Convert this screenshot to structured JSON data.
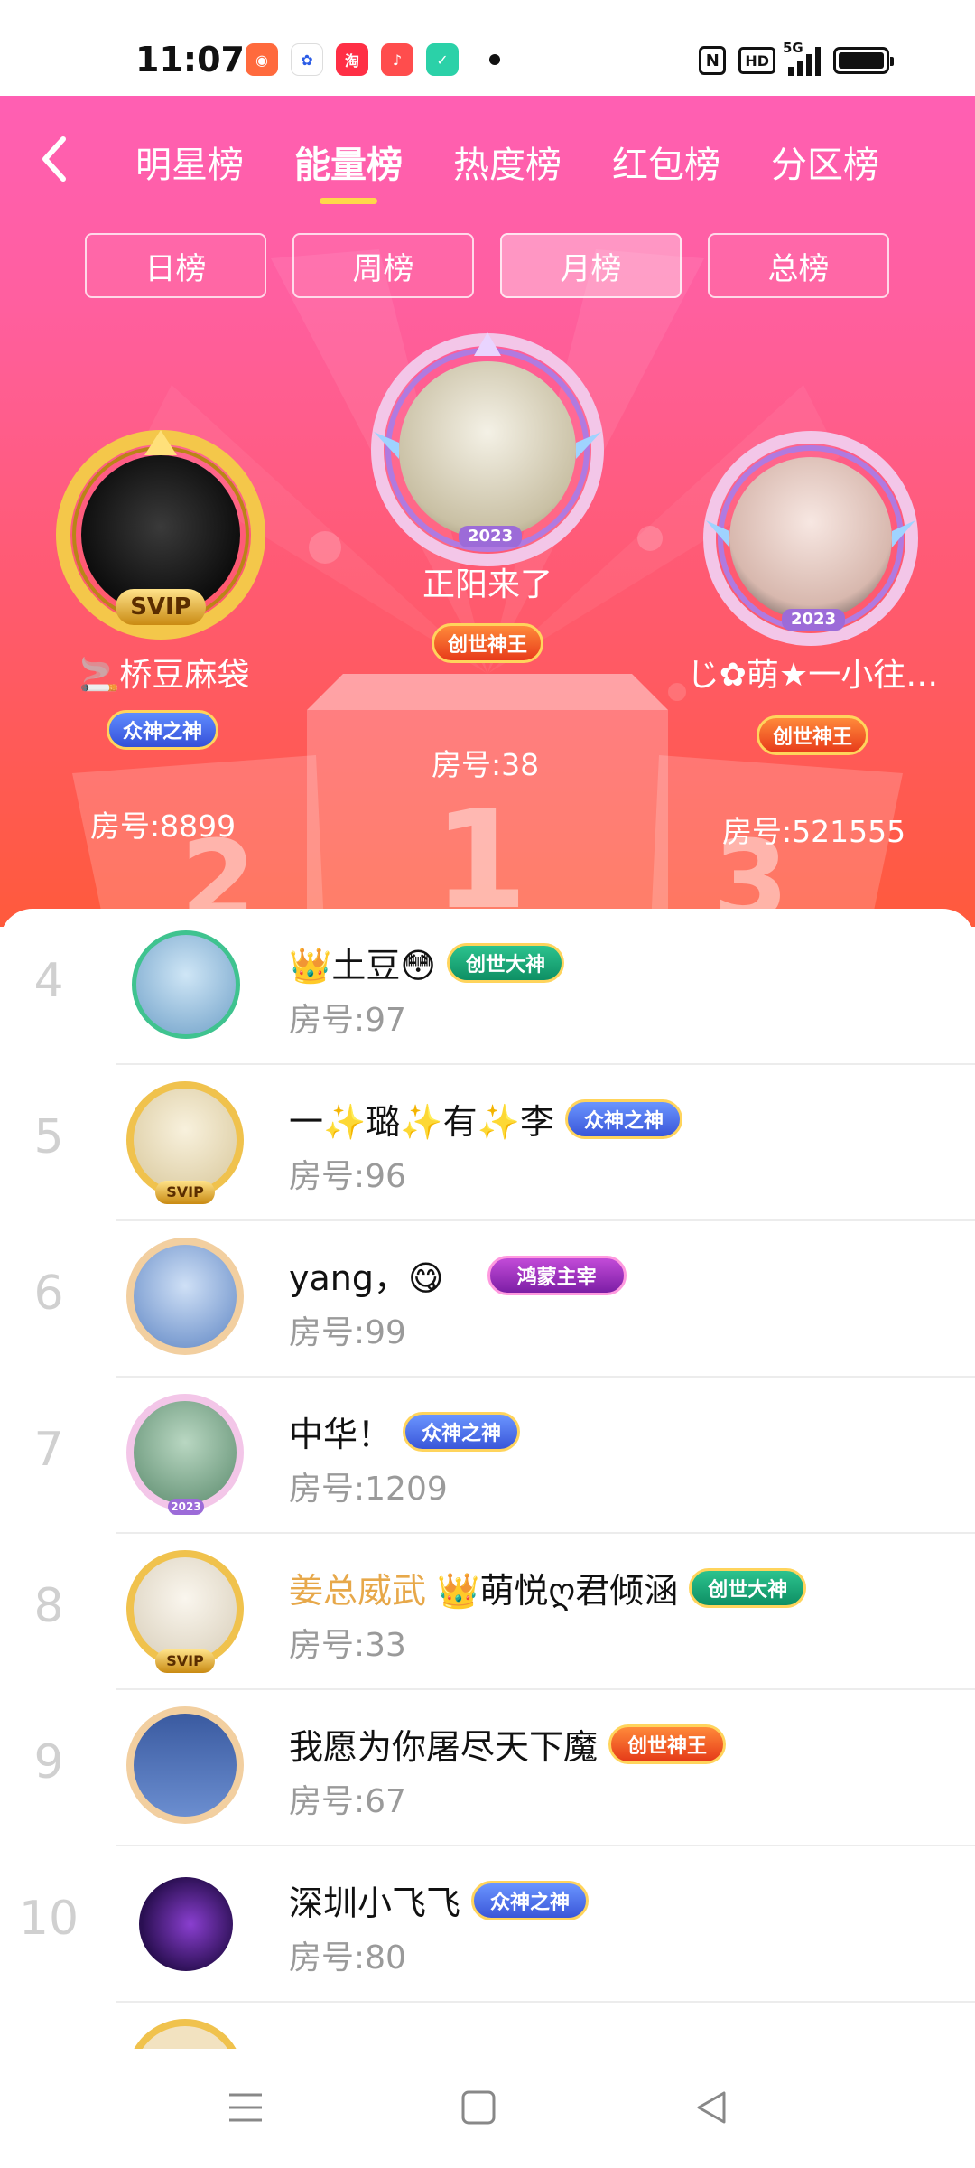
{
  "status": {
    "time": "11:07",
    "apps": [
      {
        "icon": "camera-app-icon",
        "color": "#ff6a3d",
        "glyph": "◉"
      },
      {
        "icon": "baidu-app-icon",
        "color": "#ffffff",
        "glyph": "🐾"
      },
      {
        "icon": "taote-app-icon",
        "color": "#ff2f45",
        "glyph": "淘"
      },
      {
        "icon": "music-app-icon",
        "color": "#ff4d4d",
        "glyph": "♪"
      },
      {
        "icon": "shield-app-icon",
        "color": "#2bd1a8",
        "glyph": "✓"
      }
    ],
    "hd_label": "HD",
    "nfc_label": "N",
    "network": "5G"
  },
  "header": {
    "tabs": [
      {
        "label": "明星榜",
        "active": false
      },
      {
        "label": "能量榜",
        "active": true
      },
      {
        "label": "热度榜",
        "active": false
      },
      {
        "label": "红包榜",
        "active": false
      },
      {
        "label": "分区榜",
        "active": false
      }
    ],
    "periods": [
      {
        "label": "日榜",
        "active": false
      },
      {
        "label": "周榜",
        "active": false
      },
      {
        "label": "月榜",
        "active": true
      },
      {
        "label": "总榜",
        "active": false
      }
    ]
  },
  "podium": {
    "first": {
      "name": "正阳来了",
      "badge": "创世神王",
      "room": "房号:38",
      "year": "2023",
      "number": "1"
    },
    "second": {
      "name": "桥豆麻袋",
      "prefix": "🚬",
      "badge": "众神之神",
      "room": "房号:8899",
      "frame_label": "SVIP",
      "number": "2"
    },
    "third": {
      "name": "じ✿萌★一小往…",
      "badge": "创世神王",
      "room": "房号:521555",
      "year": "2023",
      "number": "3"
    }
  },
  "list": [
    {
      "rank": "4",
      "name": "👑土豆😳",
      "badge": "创世大神",
      "badge_style": "green",
      "room": "房号:97",
      "avatar_color": "#9cc7e8"
    },
    {
      "rank": "5",
      "name": "一✨璐✨有✨李",
      "badge": "众神之神",
      "badge_style": "blue",
      "room": "房号:96",
      "avatar_color": "#f2e7cf",
      "frame": "SVIP"
    },
    {
      "rank": "6",
      "name": "yang，😋",
      "badge": "鸿蒙主宰",
      "badge_style": "purple",
      "room": "房号:99",
      "avatar_color": "#8fb4e0"
    },
    {
      "rank": "7",
      "name": "中华！",
      "badge": "众神之神",
      "badge_style": "blue",
      "room": "房号:1209",
      "avatar_color": "#7aa58d",
      "year": "2023"
    },
    {
      "rank": "8",
      "prefix": "姜总威武",
      "name": "👑萌悦ღ君倾涵",
      "badge": "创世大神",
      "badge_style": "green",
      "room": "房号:33",
      "avatar_color": "#e8e2d6",
      "frame": "SVIP"
    },
    {
      "rank": "9",
      "name": "我愿为你屠尽天下魔",
      "badge": "创世神王",
      "badge_style": "red",
      "room": "房号:67",
      "avatar_color": "#4b6aa8"
    },
    {
      "rank": "10",
      "name": "深圳小飞飞",
      "badge": "众神之神",
      "badge_style": "blue",
      "room": "房号:80",
      "avatar_color": "#3b1a66"
    }
  ]
}
